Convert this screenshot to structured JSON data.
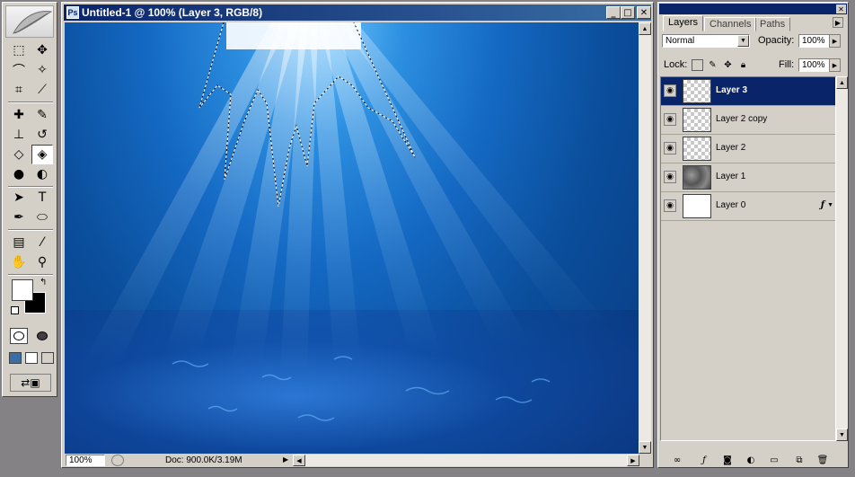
{
  "toolbox": {
    "tools": [
      {
        "name": "marquee-tool-icon",
        "glyph": "⬚"
      },
      {
        "name": "move-tool-icon",
        "glyph": "✥"
      },
      {
        "name": "lasso-tool-icon",
        "glyph": "⌒"
      },
      {
        "name": "magic-wand-tool-icon",
        "glyph": "✧"
      },
      {
        "name": "crop-tool-icon",
        "glyph": "⌗"
      },
      {
        "name": "slice-tool-icon",
        "glyph": "⟋"
      },
      {
        "name": "healing-brush-tool-icon",
        "glyph": "✚"
      },
      {
        "name": "brush-tool-icon",
        "glyph": "✎"
      },
      {
        "name": "clone-stamp-tool-icon",
        "glyph": "⊥"
      },
      {
        "name": "history-brush-tool-icon",
        "glyph": "↺"
      },
      {
        "name": "eraser-tool-icon",
        "glyph": "◇"
      },
      {
        "name": "paint-bucket-tool-icon",
        "glyph": "◈"
      },
      {
        "name": "blur-tool-icon",
        "glyph": "●"
      },
      {
        "name": "dodge-tool-icon",
        "glyph": "◐"
      },
      {
        "name": "path-selection-tool-icon",
        "glyph": "➤"
      },
      {
        "name": "type-tool-icon",
        "glyph": "T"
      },
      {
        "name": "pen-tool-icon",
        "glyph": "✒"
      },
      {
        "name": "shape-tool-icon",
        "glyph": "⬭"
      },
      {
        "name": "notes-tool-icon",
        "glyph": "▤"
      },
      {
        "name": "eyedropper-tool-icon",
        "glyph": "⁄"
      },
      {
        "name": "hand-tool-icon",
        "glyph": "✋"
      },
      {
        "name": "zoom-tool-icon",
        "glyph": "⚲"
      }
    ],
    "active_tool": "paint-bucket-tool-icon"
  },
  "document": {
    "title": "Untitled-1 @ 100% (Layer 3, RGB/8)",
    "zoom": "100%",
    "doc_info": "Doc: 900.0K/3.19M",
    "minimize_glyph": "_",
    "maximize_glyph": "□",
    "close_glyph": "✕"
  },
  "palette": {
    "tabs": [
      {
        "label": "Layers",
        "active": true
      },
      {
        "label": "Channels",
        "active": false
      },
      {
        "label": "Paths",
        "active": false
      }
    ],
    "blend_mode": "Normal",
    "opacity_label": "Opacity:",
    "opacity_value": "100%",
    "lock_label": "Lock:",
    "fill_label": "Fill:",
    "fill_value": "100%",
    "layers": [
      {
        "name": "Layer 3",
        "thumb": "checker",
        "selected": true,
        "fx": false
      },
      {
        "name": "Layer 2 copy",
        "thumb": "checker",
        "selected": false,
        "fx": false
      },
      {
        "name": "Layer 2",
        "thumb": "checker",
        "selected": false,
        "fx": false
      },
      {
        "name": "Layer 1",
        "thumb": "clouds",
        "selected": false,
        "fx": false
      },
      {
        "name": "Layer 0",
        "thumb": "white",
        "selected": false,
        "fx": true
      }
    ],
    "fx_glyph": "ƒ"
  },
  "colors": {
    "titlebar": "#0a246a",
    "panel": "#d4d0c8",
    "canvas_deep": "#0b3a80",
    "canvas_light": "#6cc4ff"
  }
}
